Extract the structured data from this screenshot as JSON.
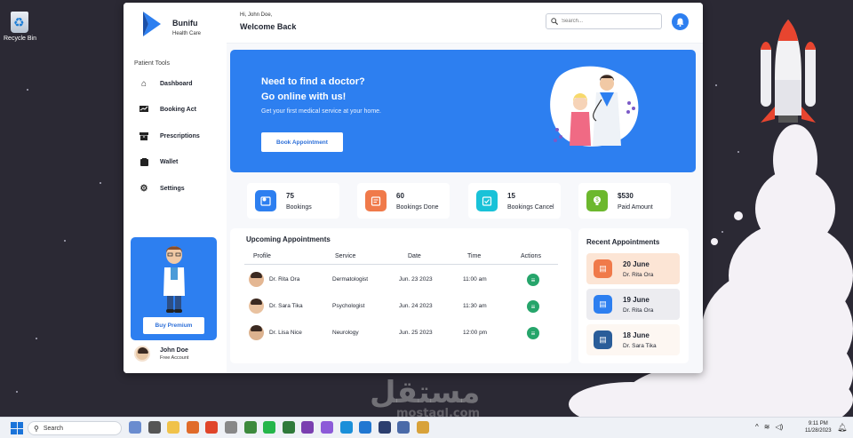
{
  "desktop": {
    "recycle_bin_label": "Recycle Bin",
    "watermark": "مستقل",
    "watermark_sub": "mostaql.com"
  },
  "sidebar": {
    "brand_name": "Bunifu",
    "brand_tagline": "Health Care",
    "section_label": "Patient Tools",
    "items": [
      {
        "label": "Dashboard",
        "icon": "home-icon"
      },
      {
        "label": "Booking Act",
        "icon": "chart-icon"
      },
      {
        "label": "Prescriptions",
        "icon": "archive-icon"
      },
      {
        "label": "Wallet",
        "icon": "wallet-icon"
      },
      {
        "label": "Settings",
        "icon": "gear-icon"
      }
    ],
    "premium_button": "Buy Premium",
    "user_name": "John Doe",
    "user_plan": "Free Account"
  },
  "header": {
    "greeting": "Hi, John Doe,",
    "welcome": "Welcome Back",
    "search_placeholder": "Search..."
  },
  "hero": {
    "line1": "Need to find a doctor?",
    "line2": "Go online with us!",
    "subtitle": "Get your first medical service at your home.",
    "button": "Book Appointment"
  },
  "stats": [
    {
      "value": "75",
      "label": "Bookings",
      "color": "#2d7ff0"
    },
    {
      "value": "60",
      "label": "Bookings Done",
      "color": "#f07a4a"
    },
    {
      "value": "15",
      "label": "Bookings Cancel",
      "color": "#19c2d8"
    },
    {
      "value": "$530",
      "label": "Paid Amount",
      "color": "#6cb82d"
    }
  ],
  "appointments": {
    "title": "Upcoming Appointments",
    "columns": [
      "Profile",
      "Service",
      "Date",
      "Time",
      "Actions"
    ],
    "rows": [
      {
        "name": "Dr. Rita Ora",
        "service": "Dermatologist",
        "date": "Jun. 23 2023",
        "time": "11:00 am"
      },
      {
        "name": "Dr. Sara Tika",
        "service": "Psychologist",
        "date": "Jun. 24 2023",
        "time": "11:30 am"
      },
      {
        "name": "Dr. Lisa Nice",
        "service": "Neurology",
        "date": "Jun. 25 2023",
        "time": "12:00 pm"
      }
    ]
  },
  "recent": {
    "title": "Recent Appointments",
    "items": [
      {
        "date": "20 June",
        "name": "Dr. Rita Ora",
        "bg": "#fce5d5",
        "icon_bg": "#f07a4a"
      },
      {
        "date": "19 June",
        "name": "Dr. Rita Ora",
        "bg": "#ececf0",
        "icon_bg": "#2d7ff0"
      },
      {
        "date": "18 June",
        "name": "Dr. Sara Tika",
        "bg": "#fdf7f2",
        "icon_bg": "#2a5d99"
      }
    ]
  },
  "taskbar": {
    "search_label": "Search",
    "time": "9:11 PM",
    "date": "11/28/2023"
  }
}
